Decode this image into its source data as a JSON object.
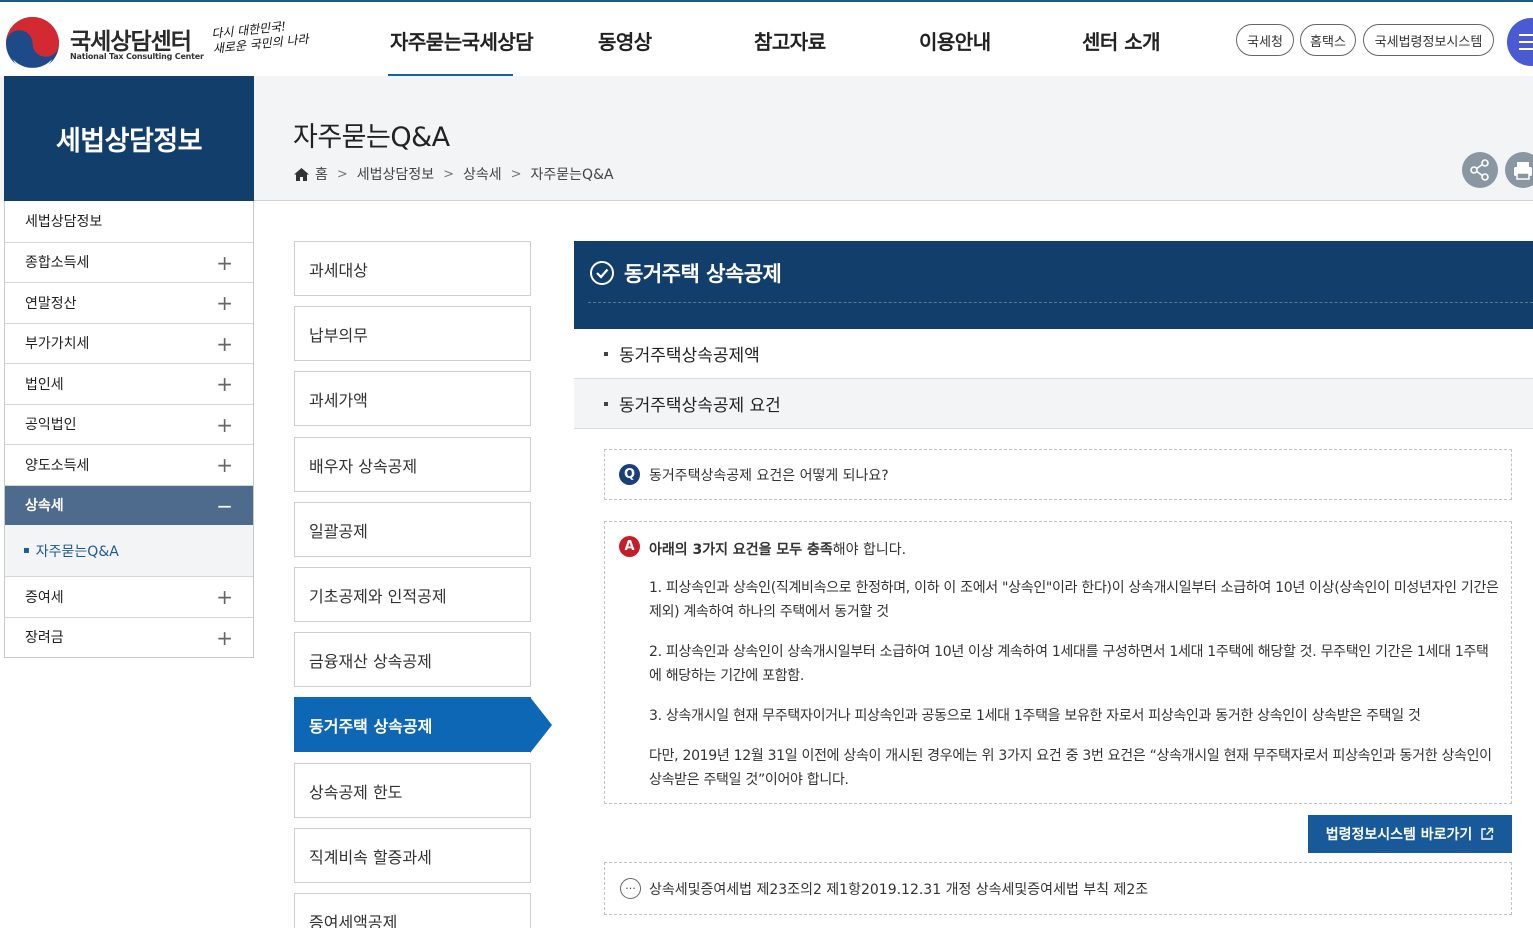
{
  "header": {
    "logo_title": "국세상담센터",
    "logo_subtitle": "National Tax Consulting Center",
    "slogan_line1": "다시 대한민국!",
    "slogan_line2": "새로운 국민의 나라",
    "nav": [
      "자주묻는국세상담",
      "동영상",
      "참고자료",
      "이용안내",
      "센터 소개"
    ],
    "links": [
      "국세청",
      "홈택스",
      "국세법령정보시스템"
    ]
  },
  "lnb": {
    "title": "세법상담정보",
    "items": [
      "세법상담정보",
      "종합소득세",
      "연말정산",
      "부가가치세",
      "법인세",
      "공익법인",
      "양도소득세",
      "상속세"
    ],
    "active_sub": "자주묻는Q&A",
    "items_after": [
      "증여세",
      "장려금"
    ],
    "plus": "+",
    "minus": "−"
  },
  "page": {
    "title": "자주묻는Q&A",
    "breadcrumb": [
      "홈",
      "세법상담정보",
      "상속세",
      "자주묻는Q&A"
    ],
    "crumb_sep": ">"
  },
  "tabs": [
    "과세대상",
    "납부의무",
    "과세가액",
    "배우자 상속공제",
    "일괄공제",
    "기초공제와 인적공제",
    "금융재산 상속공제",
    "동거주택 상속공제",
    "상속공제 한도",
    "직계비속 할증과세",
    "증여세액공제"
  ],
  "content": {
    "title": "동거주택 상속공제",
    "sub_items": [
      "동거주택상속공제액",
      "동거주택상속공제 요건"
    ],
    "q_badge": "Q",
    "question": "동거주택상속공제 요건은 어떻게 되나요?",
    "a_badge": "A",
    "answer_lead_bold": "아래의 3가지 요건을 모두 충족",
    "answer_lead_rest": "해야 합니다.",
    "answer_paras": [
      "1. 피상속인과 상속인(직계비속으로 한정하며, 이하 이 조에서 \"상속인\"이라 한다)이 상속개시일부터 소급하여 10년 이상(상속인이 미성년자인 기간은 제외) 계속하여 하나의 주택에서 동거할 것",
      "2. 피상속인과 상속인이 상속개시일부터 소급하여 10년 이상 계속하여 1세대를 구성하면서 1세대 1주택에 해당할 것. 무주택인 기간은 1세대 1주택에 해당하는 기간에 포함함.",
      "3. 상속개시일 현재 무주택자이거나 피상속인과 공동으로 1세대 1주택을 보유한 자로서 피상속인과 동거한 상속인이 상속받은 주택일 것",
      "다만, 2019년 12월 31일 이전에 상속이 개시된 경우에는 위 3가지 요건 중 3번 요건은 “상속개시일 현재 무주택자로서 피상속인과 동거한 상속인이 상속받은 주택일 것”이어야 합니다."
    ],
    "law_button": "법령정보시스템 바로가기",
    "reference": "상속세및증여세법 제23조의2 제1항2019.12.31 개정 상속세및증여세법 부칙 제2조",
    "ref_icon_glyph": "···"
  },
  "colors": {
    "navy": "#123e6b",
    "blue": "#0d67b5",
    "active_lnb": "#4e6a8c",
    "badge_q": "#1b3f78",
    "badge_a": "#c61d2b"
  }
}
